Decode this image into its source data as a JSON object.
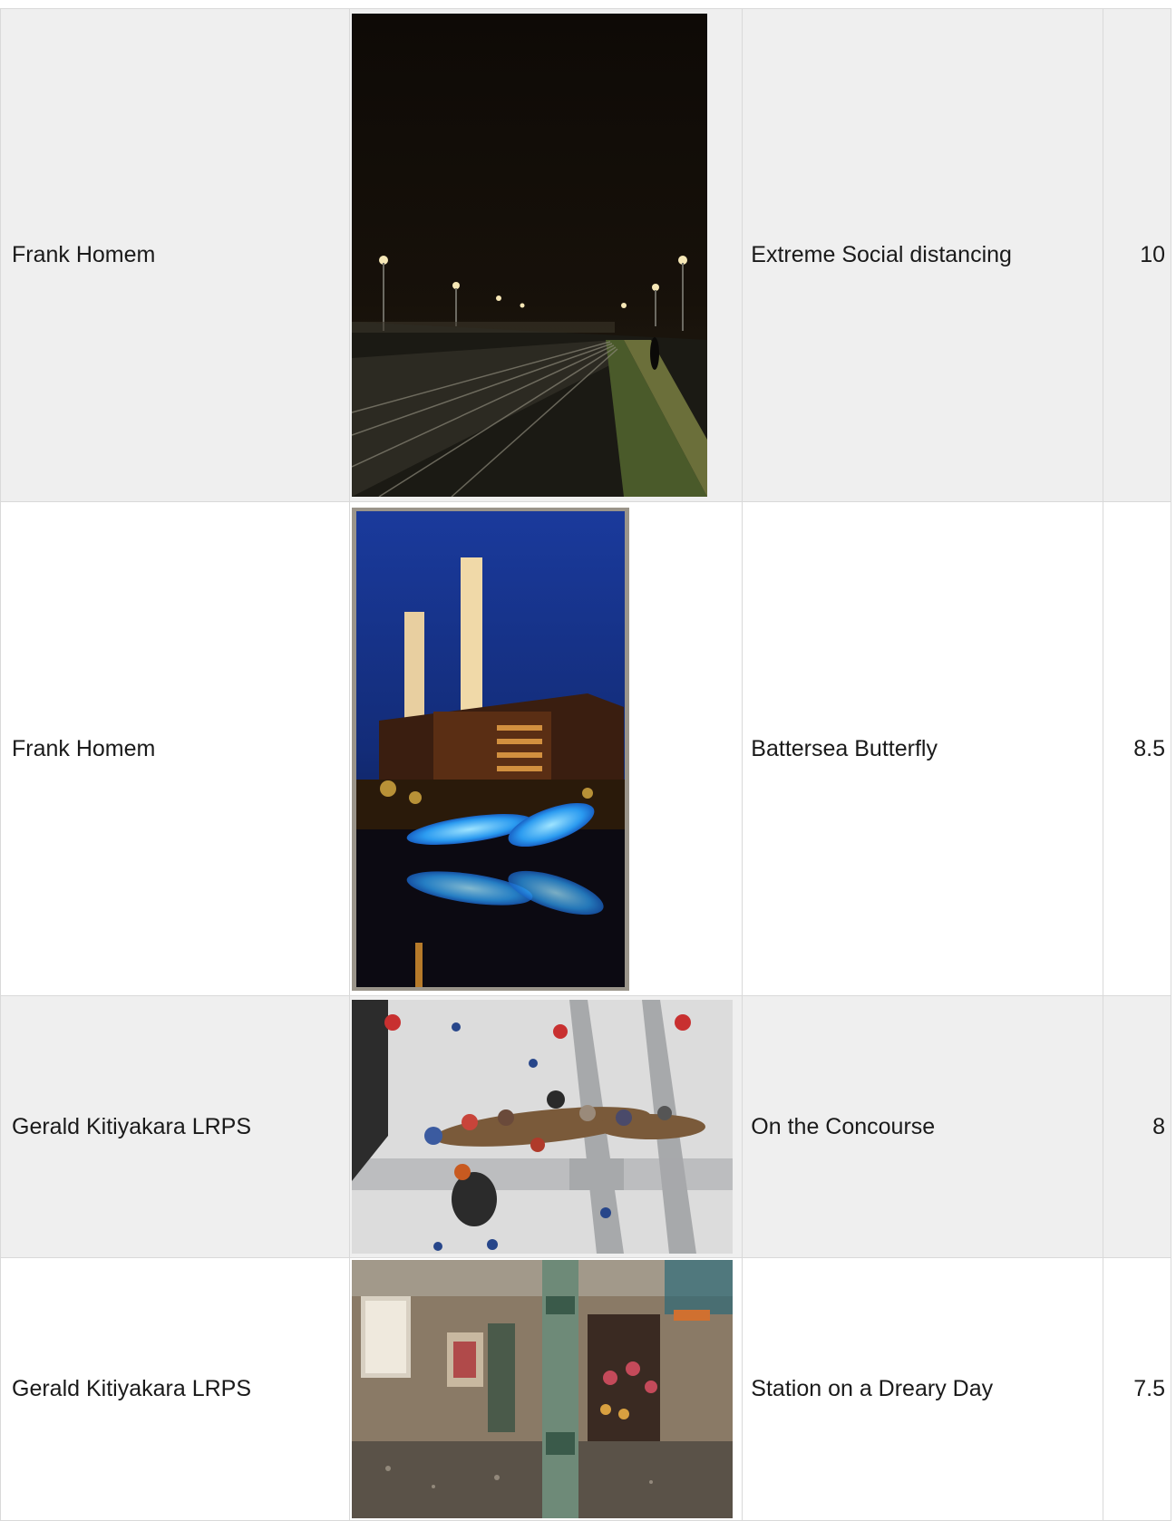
{
  "entries": [
    {
      "author": "Frank Homem",
      "title": "Extreme Social distancing",
      "score": "10"
    },
    {
      "author": "Frank Homem",
      "title": "Battersea Butterfly",
      "score": "8.5"
    },
    {
      "author": "Gerald Kitiyakara LRPS",
      "title": "On the Concourse",
      "score": "8"
    },
    {
      "author": "Gerald Kitiyakara LRPS",
      "title": "Station on a Dreary Day",
      "score": "7.5"
    }
  ]
}
